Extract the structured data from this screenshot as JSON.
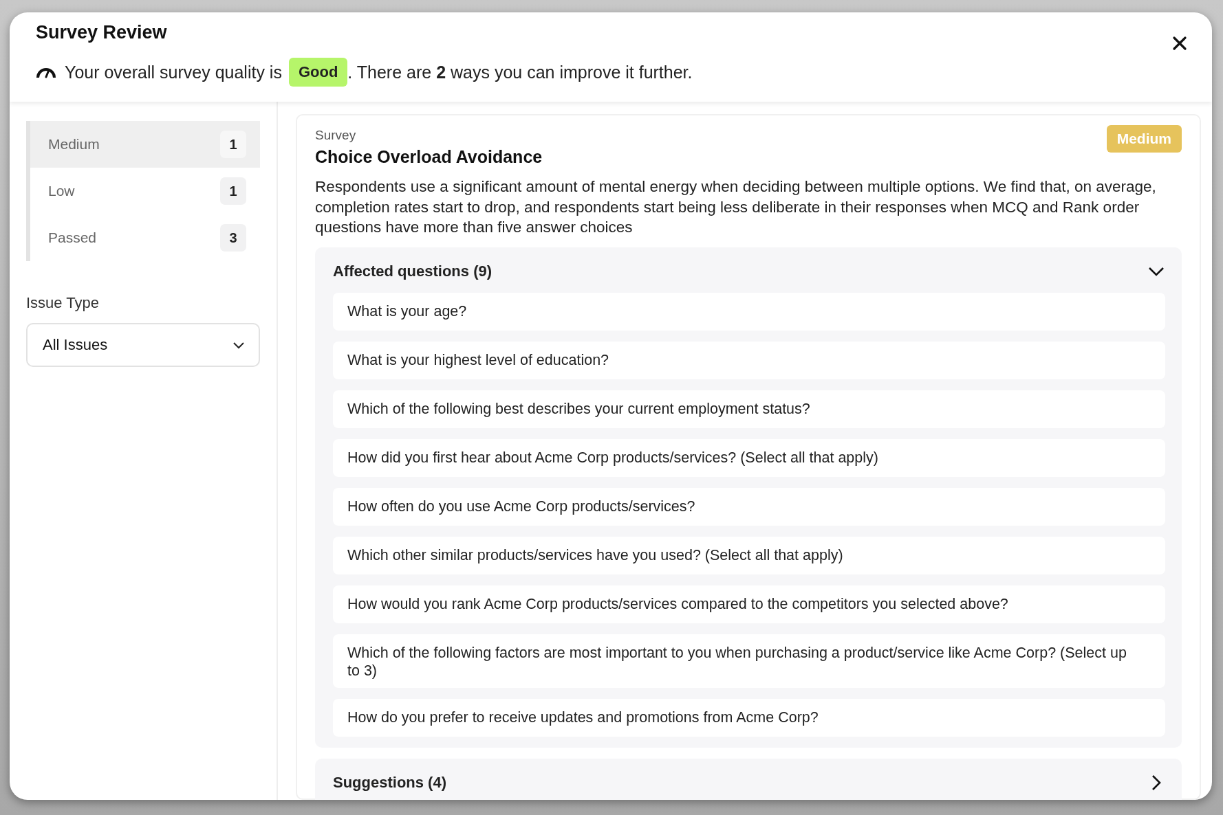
{
  "window": {
    "title": "Survey Review"
  },
  "summary": {
    "prefix": "Your overall survey quality is",
    "quality": "Good",
    "suffix": ". There are **2** ways you can improve it further."
  },
  "sidebar": {
    "items": [
      {
        "label": "Medium",
        "count": "1",
        "selected": true
      },
      {
        "label": "Low",
        "count": "1",
        "selected": false
      },
      {
        "label": "Passed",
        "count": "3",
        "selected": false
      }
    ],
    "filter": {
      "label": "Issue Type",
      "value": "All Issues"
    }
  },
  "issue": {
    "category": "Survey",
    "title": "Choice Overload Avoidance",
    "severity": "Medium",
    "description": "Respondents use a significant amount of mental energy when deciding between multiple options. We find that, on average, completion rates start to drop, and respondents start being less deliberate in their responses when MCQ and Rank order questions have more than five answer choices",
    "sections": [
      {
        "title": "Affected questions (9)",
        "expanded": true,
        "items": [
          "What is your age?",
          "What is your highest level of education?",
          "Which of the following best describes your current employment status?",
          "How did you first hear about Acme Corp products/services? (Select all that apply)",
          "How often do you use Acme Corp products/services?",
          "Which other similar products/services have you used? (Select all that apply)",
          "How would you rank Acme Corp products/services compared to the competitors you selected above?",
          "Which of the following factors are most important to you when purchasing a product/service like Acme Corp? (Select up to 3)",
          "How do you prefer to receive updates and promotions from Acme Corp?"
        ]
      },
      {
        "title": "Suggestions (4)",
        "expanded": false
      }
    ]
  }
}
